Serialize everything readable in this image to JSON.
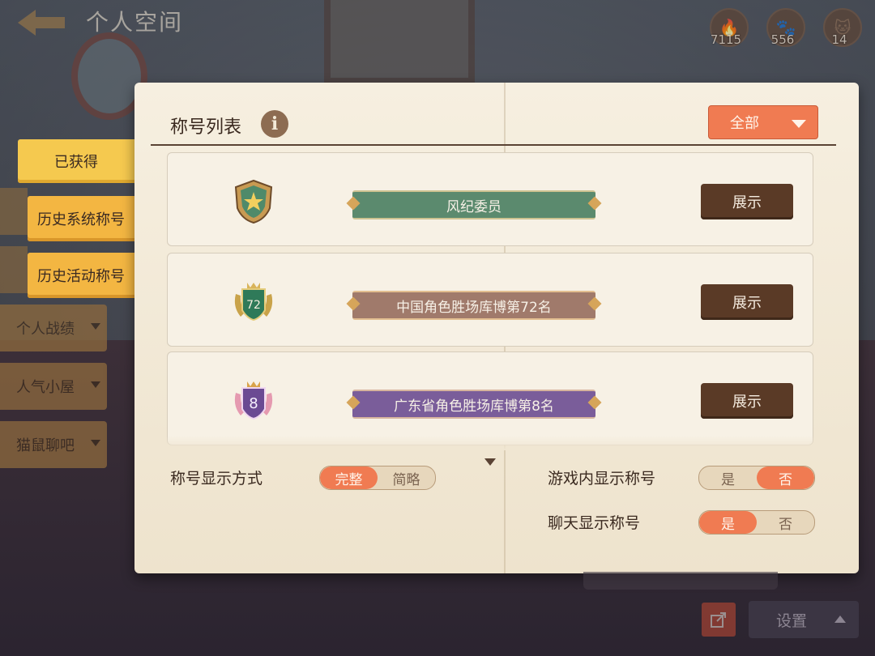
{
  "header": {
    "title": "个人空间",
    "currencies": [
      {
        "icon": "flame-icon",
        "value": "7115"
      },
      {
        "icon": "paw-icon",
        "value": "556"
      },
      {
        "icon": "cat-face-icon",
        "value": "14"
      }
    ]
  },
  "nav": {
    "obtained": "已获得",
    "history_system": "历史系统称号",
    "history_event": "历史活动称号",
    "personal_record": "个人战绩",
    "popular_house": "人气小屋",
    "cat_mouse_bar": "猫鼠聊吧"
  },
  "panel": {
    "title": "称号列表",
    "filter": {
      "selected": "全部"
    },
    "titles": [
      {
        "name": "风纪委员",
        "ribbon_color": "#5b8a6e",
        "badge": "star-shield",
        "button": "展示"
      },
      {
        "name": "中国角色胜场库博第72名",
        "ribbon_color": "#a07a6b",
        "badge": "72",
        "badge_color": "#2f7a59",
        "button": "展示"
      },
      {
        "name": "广东省角色胜场库博第8名",
        "ribbon_color": "#7a5d9a",
        "badge": "8",
        "badge_color": "#6b4a93",
        "button": "展示"
      }
    ]
  },
  "settings": {
    "display_mode_label": "称号显示方式",
    "display_mode": {
      "full": "完整",
      "brief": "简略",
      "selected": "full"
    },
    "ingame_label": "游戏内显示称号",
    "ingame": {
      "yes": "是",
      "no": "否",
      "selected": "no"
    },
    "chat_label": "聊天显示称号",
    "chat": {
      "yes": "是",
      "no": "否",
      "selected": "yes"
    }
  },
  "footer": {
    "settings_label": "设置"
  },
  "colors": {
    "accent": "#f07b52",
    "button_dark": "#5a3a26",
    "tab_active": "#f5c94f"
  }
}
